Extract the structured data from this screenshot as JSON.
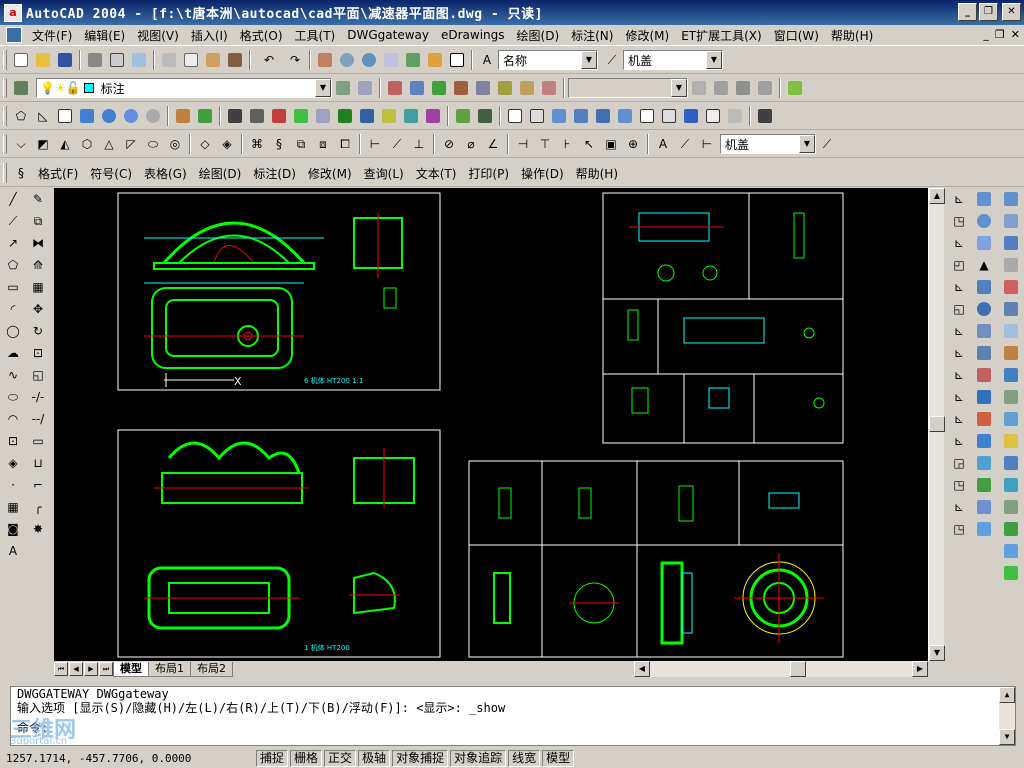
{
  "window": {
    "title": "AutoCAD 2004 - [f:\\t唐本洲\\autocad\\cad平面\\减速器平面图.dwg - 只读]",
    "app_icon_letter": "a"
  },
  "menubar": {
    "items": [
      "文件(F)",
      "编辑(E)",
      "视图(V)",
      "插入(I)",
      "格式(O)",
      "工具(T)",
      "DWGgateway",
      "eDrawings",
      "绘图(D)",
      "标注(N)",
      "修改(M)",
      "ET扩展工具(X)",
      "窗口(W)",
      "帮助(H)"
    ]
  },
  "toolbars": {
    "text_style_value": "名称",
    "dim_style_value": "机盖",
    "layer_value": "标注",
    "layer2_value": "机盖",
    "express_menu": [
      "格式(F)",
      "符号(C)",
      "表格(G)",
      "绘图(D)",
      "标注(D)",
      "修改(M)",
      "查询(L)",
      "文本(T)",
      "打印(P)",
      "操作(D)",
      "帮助(H)"
    ]
  },
  "layout_tabs": [
    "模型",
    "布局1",
    "布局2"
  ],
  "sheet_labels": {
    "tl": "6 机体 HT200  1:1",
    "bl": "1 机体 HT200"
  },
  "command": {
    "line1": "DWGGATEWAY DWGgateway",
    "line2": "输入选项 [显示(S)/隐藏(H)/左(L)/右(R)/上(T)/下(B)/浮动(F)]: <显示>: _show",
    "line3": "命令:"
  },
  "status": {
    "coords": "1257.1714, -457.7706, 0.0000",
    "buttons": [
      "捕捉",
      "栅格",
      "正交",
      "极轴",
      "对象捕捉",
      "对象追踪",
      "线宽",
      "模型"
    ]
  },
  "watermark": {
    "main": "三维网",
    "sub": "3dportal.cn"
  },
  "colors": {
    "title_start": "#0a246a",
    "title_end": "#3a6ea5",
    "canvas": "#000000",
    "cad_green": "#00ff00",
    "cad_cyan": "#00ffff",
    "cad_red": "#ff0000",
    "cad_yellow": "#ffff00"
  }
}
